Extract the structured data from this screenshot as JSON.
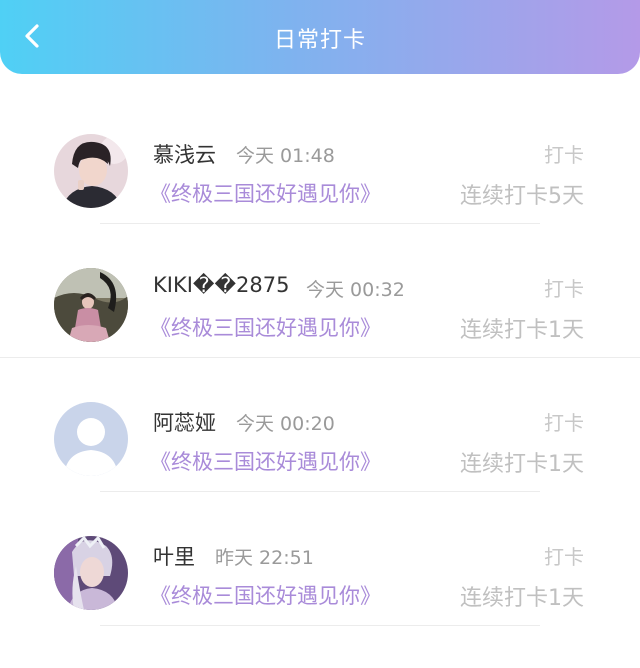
{
  "header": {
    "title": "日常打卡",
    "back_icon": "chevron-left-icon",
    "gradient_start": "#4fd0f5",
    "gradient_end": "#b49ae8"
  },
  "list": {
    "items": [
      {
        "name": "慕浅云",
        "time": "今天 01:48",
        "game": "《终极三国还好遇见你》",
        "action": "打卡",
        "streak": "连续打卡5天",
        "avatar": "user-photo"
      },
      {
        "name": "KIKI��2875",
        "time": "今天 00:32",
        "game": "《终极三国还好遇见你》",
        "action": "打卡",
        "streak": "连续打卡1天",
        "avatar": "user-photo"
      },
      {
        "name": "阿蕊娅",
        "time": "今天 00:20",
        "game": "《终极三国还好遇见你》",
        "action": "打卡",
        "streak": "连续打卡1天",
        "avatar": "default-avatar"
      },
      {
        "name": "叶里",
        "time": "昨天 22:51",
        "game": "《终极三国还好遇见你》",
        "action": "打卡",
        "streak": "连续打卡1天",
        "avatar": "user-photo"
      }
    ]
  },
  "colors": {
    "game_title": "#a98bd9",
    "name": "#333333",
    "muted": "#c0c0c0"
  }
}
